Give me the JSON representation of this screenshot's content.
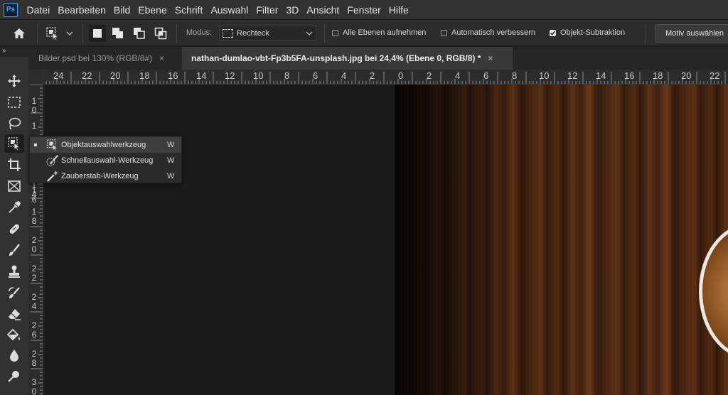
{
  "app": {
    "logo": "Ps"
  },
  "menu": [
    "Datei",
    "Bearbeiten",
    "Bild",
    "Ebene",
    "Schrift",
    "Auswahl",
    "Filter",
    "3D",
    "Ansicht",
    "Fenster",
    "Hilfe"
  ],
  "options": {
    "modus_label": "Modus:",
    "modus_value": "Rechteck",
    "checkbox_all_layers": {
      "label": "Alle Ebenen aufnehmen",
      "checked": false
    },
    "checkbox_auto_improve": {
      "label": "Automatisch verbessern",
      "checked": false
    },
    "checkbox_subtract": {
      "label": "Objekt-Subtraktion",
      "checked": true
    },
    "motiv_button": "Motiv auswählen"
  },
  "panel_collapse": "»",
  "tabs": [
    {
      "title": "Bilder.psd bei 130% (RGB/8#)",
      "close": "×",
      "active": false
    },
    {
      "title": "nathan-dumlao-vbt-Fp3b5FA-unsplash.jpg bei 24,4% (Ebene 0, RGB/8) *",
      "close": "×",
      "active": true
    }
  ],
  "ruler_h": [
    "24",
    "22",
    "20",
    "18",
    "16",
    "14",
    "12",
    "10",
    "8",
    "6",
    "4",
    "2",
    "0",
    "2",
    "4",
    "6",
    "8",
    "10",
    "12",
    "14",
    "16",
    "18",
    "20",
    "22"
  ],
  "ruler_v": [
    "1\n0",
    "1",
    "1\n4",
    "1\n6",
    "1\n8",
    "2\n0",
    "2\n2",
    "2\n4",
    "2\n6",
    "2\n8",
    "3\n0"
  ],
  "flyout": [
    {
      "label": "Objektauswahlwerkzeug",
      "key": "W",
      "selected": true,
      "icon": "object-selection-icon"
    },
    {
      "label": "Schnellauswahl-Werkzeug",
      "key": "W",
      "selected": false,
      "icon": "quick-selection-icon"
    },
    {
      "label": "Zauberstab-Werkzeug",
      "key": "W",
      "selected": false,
      "icon": "magic-wand-icon"
    }
  ],
  "colors": {
    "accent": "#31a8ff",
    "menubar": "#323232",
    "canvas": "#1b1b1b"
  }
}
